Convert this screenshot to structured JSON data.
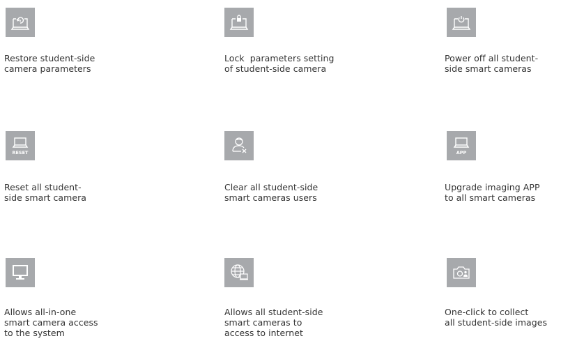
{
  "features": [
    {
      "icon": "restore-camera-icon",
      "caption_lines": [
        "Restore student-side",
        "camera parameters"
      ]
    },
    {
      "icon": "lock-parameters-icon",
      "caption_lines": [
        "Lock  parameters setting",
        "of student-side camera"
      ]
    },
    {
      "icon": "power-off-icon",
      "caption_lines": [
        "Power off all student-",
        "side smart cameras"
      ]
    },
    {
      "icon": "reset-camera-icon",
      "icon_label": "RESET",
      "caption_lines": [
        "Reset all student-",
        "side smart camera"
      ]
    },
    {
      "icon": "clear-users-icon",
      "caption_lines": [
        "Clear all student-side",
        "smart cameras users"
      ]
    },
    {
      "icon": "upgrade-app-icon",
      "icon_label": "APP",
      "caption_lines": [
        "Upgrade imaging APP",
        "to all smart cameras"
      ]
    },
    {
      "icon": "monitor-access-icon",
      "caption_lines": [
        "Allows all-in-one",
        "smart camera access",
        "to the system"
      ]
    },
    {
      "icon": "internet-access-icon",
      "caption_lines": [
        "Allows all student-side",
        "smart cameras to",
        "access to internet"
      ]
    },
    {
      "icon": "collect-images-icon",
      "caption_lines": [
        "One-click to collect",
        "all student-side images"
      ]
    }
  ],
  "colors": {
    "icon_background": "#a7a9ac",
    "icon_foreground": "#ffffff",
    "text": "#333333"
  }
}
